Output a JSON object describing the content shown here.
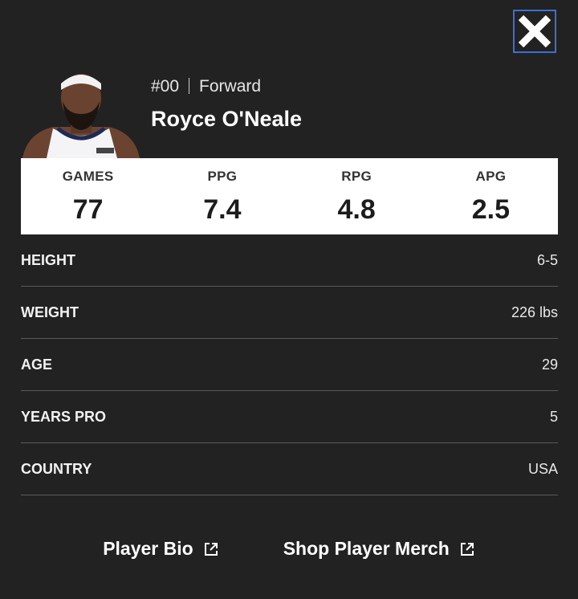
{
  "close": {
    "icon": "close-icon"
  },
  "player": {
    "number": "#00",
    "position": "Forward",
    "name": "Royce O'Neale",
    "headshot_icon": "player-headshot"
  },
  "stats": [
    {
      "label": "GAMES",
      "value": "77"
    },
    {
      "label": "PPG",
      "value": "7.4"
    },
    {
      "label": "RPG",
      "value": "4.8"
    },
    {
      "label": "APG",
      "value": "2.5"
    }
  ],
  "info": [
    {
      "label": "HEIGHT",
      "value": "6-5"
    },
    {
      "label": "WEIGHT",
      "value": "226 lbs"
    },
    {
      "label": "AGE",
      "value": "29"
    },
    {
      "label": "YEARS PRO",
      "value": "5"
    },
    {
      "label": "COUNTRY",
      "value": "USA"
    }
  ],
  "links": {
    "bio": "Player Bio",
    "merch": "Shop Player Merch",
    "icon": "external-link-icon"
  },
  "colors": {
    "background": "#222222",
    "close_border": "#3b6fd6"
  }
}
